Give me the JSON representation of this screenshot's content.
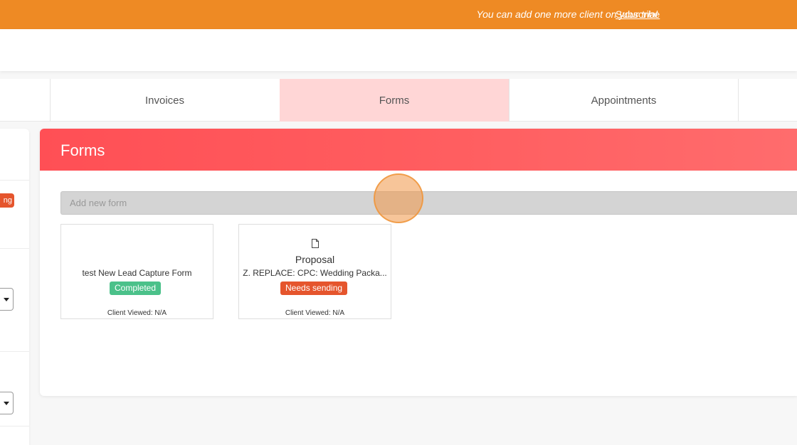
{
  "banner": {
    "message": "You can add one more client on your trial",
    "link_label": "Subscribe"
  },
  "tabs": [
    {
      "label": "Invoices"
    },
    {
      "label": "Forms"
    },
    {
      "label": "Appointments"
    }
  ],
  "side_panel": {
    "badge_label": "ng"
  },
  "forms_card": {
    "title": "Forms",
    "input_placeholder": "Add new form",
    "tiles": [
      {
        "type_label": "",
        "name": "test New Lead Capture Form",
        "status": "Completed",
        "viewed": "Client Viewed: N/A"
      },
      {
        "type_label": "Proposal",
        "name": "Z. REPLACE: CPC: Wedding Packa...",
        "status": "Needs sending",
        "viewed": "Client Viewed: N/A",
        "icon": "document-icon"
      }
    ]
  },
  "colors": {
    "banner": "#ee8a24",
    "active_tab": "#ffd6d6",
    "card_header": "#ff5a5f",
    "status_completed": "#4bc18a",
    "status_needs_sending": "#e5552d"
  }
}
